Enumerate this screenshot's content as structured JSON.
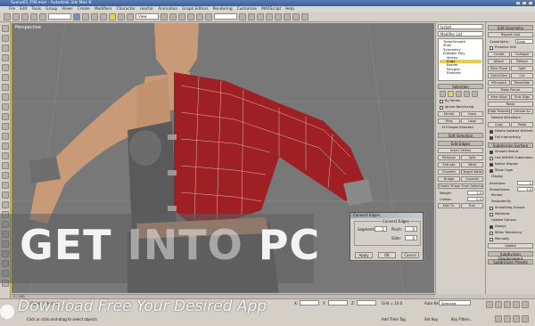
{
  "window": {
    "title": "Scene01_FIN.max - Autodesk 3ds Max 8"
  },
  "menu": [
    "File",
    "Edit",
    "Tools",
    "Group",
    "Views",
    "Create",
    "Modifiers",
    "Character",
    "reactor",
    "Animation",
    "Graph Editors",
    "Rendering",
    "Customize",
    "MAXScript",
    "Help"
  ],
  "toolbar": {
    "view_select": "View",
    "named_select": ""
  },
  "viewport": {
    "label": "Perspective"
  },
  "dialog": {
    "title": "Connect Edges",
    "group_label": "Connect Edges",
    "segments_label": "Segments:",
    "segments_value": "1",
    "pinch_label": "Pinch:",
    "pinch_value": "0",
    "slide_label": "Slide:",
    "slide_value": "0",
    "apply": "Apply",
    "ok": "OK",
    "cancel": "Cancel"
  },
  "panel": {
    "object_name": "Jacket",
    "modifier_list": "Modifier List",
    "stack_items": [
      "TurboSmooth",
      "Shell",
      "Symmetry",
      "Editable Poly",
      "Vertex",
      "Edge",
      "Border",
      "Polygon",
      "Element"
    ],
    "stack_selected": "Edge",
    "selection_rollout": "Selection",
    "by_vertex": "By Vertex",
    "ignore_backfacing": "Ignore Backfacing",
    "shrink": "Shrink",
    "grow": "Grow",
    "ring": "Ring",
    "loop": "Loop",
    "edges_selected": "123 Edges Selected",
    "soft_selection": "Soft Selection",
    "edit_edges": "Edit Edges",
    "insert_vertex": "Insert Vertex",
    "remove": "Remove",
    "split": "Split",
    "extrude": "Extrude",
    "weld": "Weld",
    "chamfer": "Chamfer",
    "target_weld": "Target Weld",
    "bridge": "Bridge",
    "connect": "Connect",
    "create_shape": "Create Shape From Selection",
    "weight_label": "Weight:",
    "weight_value": "1.0",
    "crease_label": "Crease:",
    "crease_value": "0.0",
    "edit_tri": "Edit Tri.",
    "turn": "Turn"
  },
  "panel2": {
    "edit_geometry": "Edit Geometry",
    "repeat_last": "Repeat Last",
    "constraints_label": "Constraints:",
    "constraints_value": "Edge",
    "preserve_uvs": "Preserve UVs",
    "create": "Create",
    "collapse": "Collapse",
    "attach": "Attach",
    "detach": "Detach",
    "slice_plane": "Slice Plane",
    "split": "Split",
    "quickslice": "QuickSlice",
    "cut": "Cut",
    "msmooth": "MSmooth",
    "tessellate": "Tessellate",
    "make_planar": "Make Planar",
    "view_align": "View Align",
    "grid_align": "Grid Align",
    "relax": "Relax",
    "hide_selected": "Hide Selected",
    "unhide_all": "Unhide All",
    "named_selections": "Named Selections:",
    "copy": "Copy",
    "paste": "Paste",
    "delete_isolated": "Delete Isolated Vertices",
    "full_interactivity": "Full Interactivity",
    "subdivision_surface": "Subdivision Surface",
    "smooth_result": "Smooth Result",
    "use_nurms": "Use NURMS Subdivision",
    "isoline_display": "Isoline Display",
    "show_cage": "Show Cage",
    "display": "Display",
    "iterations_label": "Iterations:",
    "iterations_value": "1",
    "smoothness_label": "Smoothness:",
    "smoothness_value": "1.0",
    "render": "Render",
    "separate_by": "Separate By",
    "smoothing_groups": "Smoothing Groups",
    "materials": "Materials",
    "update_options": "Update Options",
    "always": "Always",
    "when_rendering": "When Rendering",
    "manually": "Manually",
    "update": "Update",
    "subdivision_displacement": "Subdivision Displacement",
    "subdivision_presets": "Subdivision Presets"
  },
  "status": {
    "trackbar": "0 / 100",
    "selected": "1 Object Selected",
    "prompt": "Click or click-and-drag to select objects",
    "x": "X:",
    "y": "Y:",
    "z": "Z:",
    "grid": "Grid = 10.0",
    "add_time_tag": "Add Time Tag",
    "auto_key": "Auto Key",
    "set_key": "Set Key",
    "selected_dropdown": "Selected",
    "key_filters": "Key Filters..."
  },
  "watermark": {
    "get": "GET ",
    "into": "INTO",
    "pc": " PC",
    "subtitle": "Download Free Your Desired App"
  },
  "colors": {
    "jacket": "#9e1f24",
    "skin": "#c89a78",
    "viewport_bg": "#787878",
    "highlight": "#e8cf48"
  }
}
